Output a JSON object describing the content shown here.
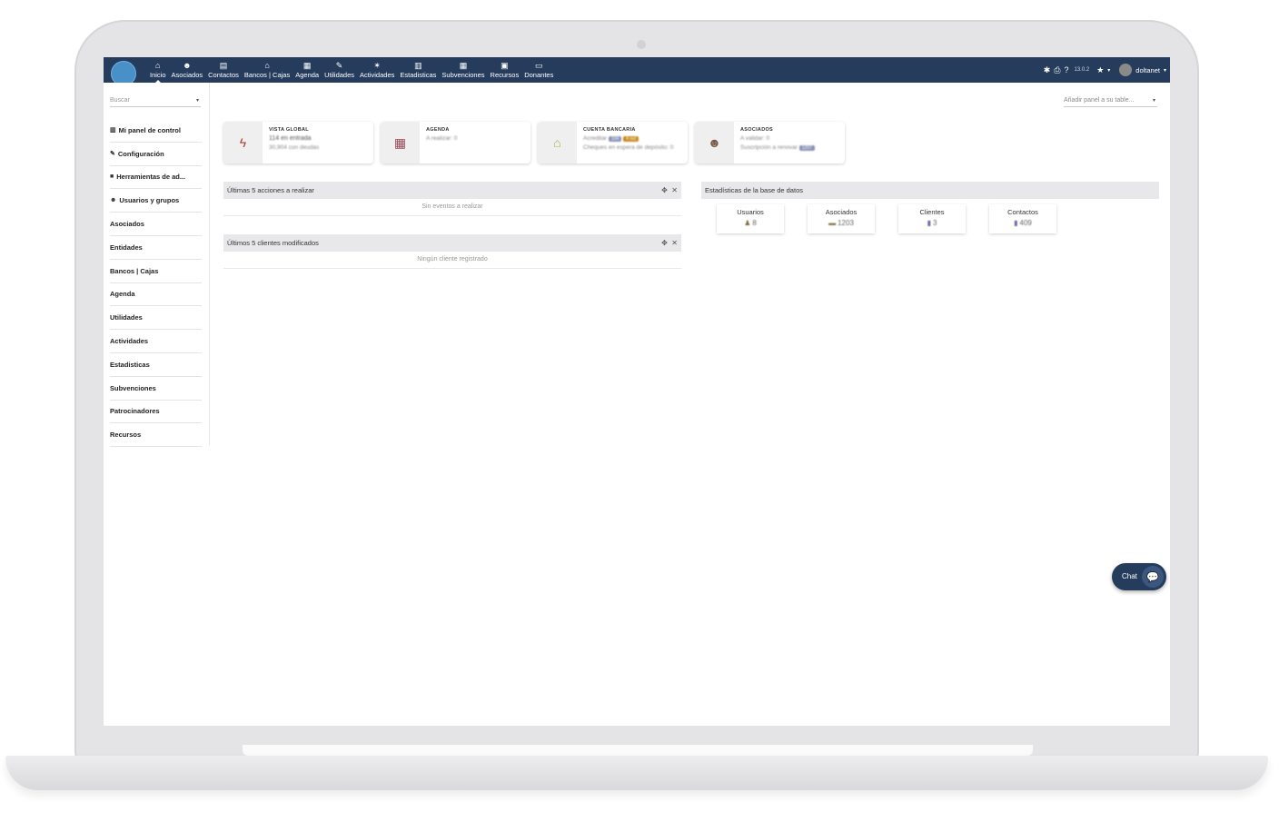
{
  "topbar": {
    "nav": [
      {
        "icon": "home-icon",
        "glyph": "⌂",
        "label": "Inicio",
        "active": true
      },
      {
        "icon": "users-icon",
        "glyph": "☻",
        "label": "Asociados"
      },
      {
        "icon": "building-icon",
        "glyph": "▤",
        "label": "Contactos"
      },
      {
        "icon": "bank-icon",
        "glyph": "⌂",
        "label": "Bancos | Cajas"
      },
      {
        "icon": "calendar-icon",
        "glyph": "▦",
        "label": "Agenda"
      },
      {
        "icon": "wrench-icon",
        "glyph": "✎",
        "label": "Utilidades"
      },
      {
        "icon": "activity-icon",
        "glyph": "✶",
        "label": "Actividades"
      },
      {
        "icon": "chart-icon",
        "glyph": "▥",
        "label": "Estadisticas"
      },
      {
        "icon": "grant-icon",
        "glyph": "▦",
        "label": "Subvenciones"
      },
      {
        "icon": "resources-icon",
        "glyph": "▣",
        "label": "Recursos"
      },
      {
        "icon": "donors-icon",
        "glyph": "▭",
        "label": "Donantes"
      }
    ],
    "version": "13.0.2",
    "user": "doltanet"
  },
  "sidebar": {
    "search_placeholder": "Buscar",
    "items": [
      {
        "icon": "dashboard-icon",
        "glyph": "▥",
        "label": "Mi panel de control"
      },
      {
        "icon": "wrench-icon",
        "glyph": "✎",
        "label": "Configuración"
      },
      {
        "icon": "tools-icon",
        "glyph": "■",
        "label": "Herramientas de ad..."
      },
      {
        "icon": "users-icon",
        "glyph": "☻",
        "label": "Usuarios y grupos"
      },
      {
        "label": "Asociados"
      },
      {
        "label": "Entidades"
      },
      {
        "label": "Bancos | Cajas"
      },
      {
        "label": "Agenda"
      },
      {
        "label": "Utilidades"
      },
      {
        "label": "Actividades"
      },
      {
        "label": "Estadisticas"
      },
      {
        "label": "Subvenciones"
      },
      {
        "label": "Patrocinadores"
      },
      {
        "label": "Recursos"
      }
    ]
  },
  "main": {
    "add_panel": "Añadir panel a su table...",
    "boxes": [
      {
        "title": "VISTA GLOBAL",
        "icon": "lightning-icon",
        "color": "#b03a2e",
        "line1": "114 en entrada",
        "line2": "30,904 con deudas"
      },
      {
        "title": "AGENDA",
        "icon": "calendar-icon",
        "color": "#a04a5a",
        "line1": "A realizar: 0",
        "line2": ""
      },
      {
        "title": "CUENTA BANCARIA",
        "icon": "bank-icon",
        "color": "#b5b04a",
        "line1": "Acreditar",
        "badge1": "104",
        "badge2": "4 out",
        "line2": "Cheques en espera de depósito: 0"
      },
      {
        "title": "ASOCIADOS",
        "icon": "users-icon",
        "color": "#7a5a4a",
        "line1": "A validar: 0",
        "line2": "Suscripción a renovar",
        "badge3": "1207"
      }
    ],
    "panel_actions": {
      "title": "Últimas 5 acciones a realizar",
      "empty": "Sin eventos a realizar"
    },
    "panel_clients": {
      "title": "Últimos 5 clientes modificados",
      "empty": "Ningún cliente registrado"
    },
    "panel_stats": {
      "title": "Estadísticas de la base de datos"
    },
    "stats": [
      {
        "label": "Usuarios",
        "value": "8",
        "icon": "user-icon"
      },
      {
        "label": "Asociados",
        "value": "1203",
        "icon": "members-icon"
      },
      {
        "label": "Clientes",
        "value": "3",
        "icon": "client-icon"
      },
      {
        "label": "Contactos",
        "value": "409",
        "icon": "contact-icon"
      }
    ],
    "chat_label": "Chat"
  }
}
